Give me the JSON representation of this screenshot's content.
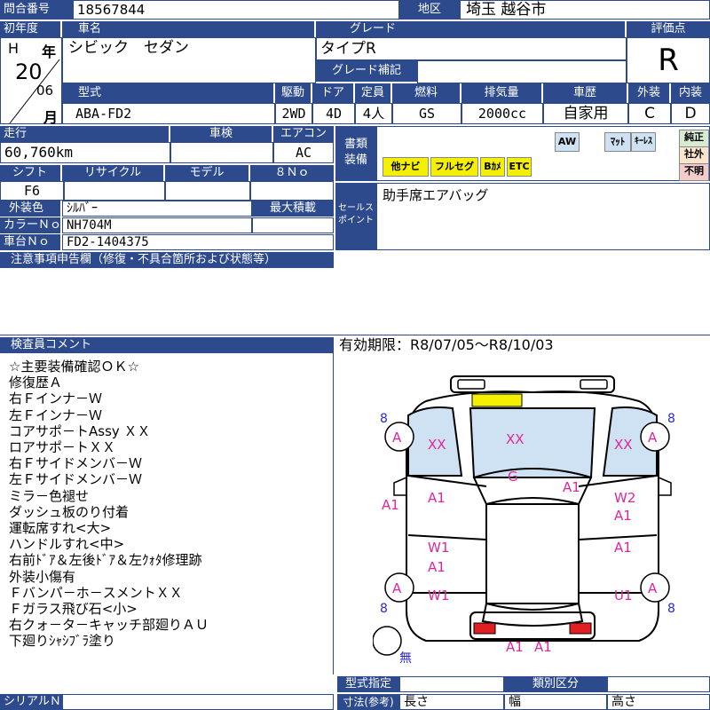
{
  "header": {
    "inquiry_label": "問合番号",
    "inquiry_value": "18567844",
    "region_label": "地区",
    "region_value": "埼玉 越谷市"
  },
  "vehicle": {
    "first_reg_label": "初年度",
    "era": "H",
    "year_label": "年",
    "year": "20",
    "month": "06",
    "month_label": "月",
    "car_name_label": "車名",
    "car_name": "シビック　セダン",
    "grade_label": "グレード",
    "grade": "タイプR",
    "grade_supp_label": "グレード補記",
    "grade_supp": "",
    "score_label": "評価点",
    "score": "R"
  },
  "spec": {
    "model_label": "型式",
    "model": "ABA-FD2",
    "drive_label": "駆動",
    "drive": "2WD",
    "doors_label": "ドア",
    "doors": "4D",
    "capacity_label": "定員",
    "capacity": "4人",
    "fuel_label": "燃料",
    "fuel": "GS",
    "displacement_label": "排気量",
    "displacement": "2000cc",
    "history_label": "車歴",
    "history": "自家用",
    "exterior_label": "外装",
    "exterior": "C",
    "interior_label": "内装",
    "interior": "D"
  },
  "details": {
    "mileage_label": "走行",
    "mileage": "60,760km",
    "inspection_label": "車検",
    "inspection": "",
    "ac_label": "エアコン",
    "ac": "AC",
    "shift_label": "シフト",
    "shift": "F6",
    "recycle_label": "リサイクル",
    "recycle": "",
    "model_year_label": "モデル",
    "model_year": "",
    "eight_no_label": "８Ｎｏ",
    "eight_no": "",
    "ext_color_label": "外装色",
    "ext_color": "ｼﾙﾊﾞｰ",
    "max_load_label": "最大積載",
    "max_load": "",
    "color_no_label": "カラーＮｏ",
    "color_no": "NH704M",
    "chassis_no_label": "車台Ｎｏ",
    "chassis_no": "FD2-1404375"
  },
  "equipment": {
    "label_line1": "書類",
    "label_line2": "装備",
    "tags_right": [
      "AW",
      "ﾏｯﾄ",
      "ｷｰﾚｽ"
    ],
    "tags_bottom": [
      "他ナビ",
      "フルセグ",
      "Bｶﾒ",
      "ETC"
    ],
    "side_tags": [
      "純正",
      "社外",
      "不明"
    ]
  },
  "sales": {
    "label_line1": "セールス",
    "label_line2": "ポイント",
    "text": "助手席エアバッグ"
  },
  "notes": {
    "label": "注意事項申告欄（修復・不具合箇所および状態等）",
    "text": ""
  },
  "inspector": {
    "label": "検査員コメント",
    "lines": [
      "☆主要装備確認ＯＫ☆",
      "修復歴Ａ",
      "右Ｆインナ－Ｗ",
      "左Ｆインナ－Ｗ",
      "コアサポ－トAssy ＸＸ",
      "ロアサポ－トＸＸ",
      "右Ｆサイドメンバ－Ｗ",
      "左Ｆサイドメンバ－Ｗ",
      "ミラ－色褪せ",
      "ダッシュ板のり付着",
      "運転席すれ<大>",
      "ハンドルすれ<中>",
      "右前ﾄﾞｱ＆左後ﾄﾞｱ＆左ｸｫﾀ修理跡",
      "外装小傷有",
      "Ｆバンパ－ホ－スメントＸＸ",
      "Ｆガラス飛び石<小>",
      "右クォ－タ－キャッチ部廻りＡＵ",
      "下廻りｼｬｼﾌﾞﾗ塗り"
    ]
  },
  "validity": {
    "text": "有効期限：R8/07/05～R8/10/03"
  },
  "diagram": {
    "marks": {
      "xx_left": "XX",
      "xx_center": "XX",
      "xx_right": "XX",
      "a_front_left": "A",
      "a_front_right": "A",
      "a_rear_left": "A",
      "a_rear_right": "A",
      "a1_left_front": "A1",
      "a1_lf_door": "A1",
      "w1_lf_door": "W1",
      "a1_lr_door": "A1",
      "w1_lr": "W1",
      "g_roof": "G",
      "a1_roof": "A1",
      "w2_rf": "W2",
      "a1_rf": "A1",
      "a1_rr": "A1",
      "u1_rr": "U1",
      "a1_rear1": "A1",
      "a1_rear2": "A1",
      "n8_fl": "8",
      "n8_fr": "8",
      "n8_rl": "8",
      "n8_rr": "8",
      "none": "無"
    }
  },
  "footer": {
    "serial_label": "シリアルＮｏ",
    "serial": "",
    "model_designation_label": "型式指定",
    "model_designation": "",
    "classification_label": "類別区分",
    "classification": "",
    "dimensions_label": "寸法(参考)",
    "length_label": "長さ",
    "width_label": "幅",
    "height_label": "高さ"
  },
  "colors": {
    "header_blue": "#2c4a8c",
    "glass_blue": "#cfe2f3",
    "mark_magenta": "#e0269a",
    "lamp_yellow": "#f5f000",
    "lamp_red": "#e02020"
  }
}
